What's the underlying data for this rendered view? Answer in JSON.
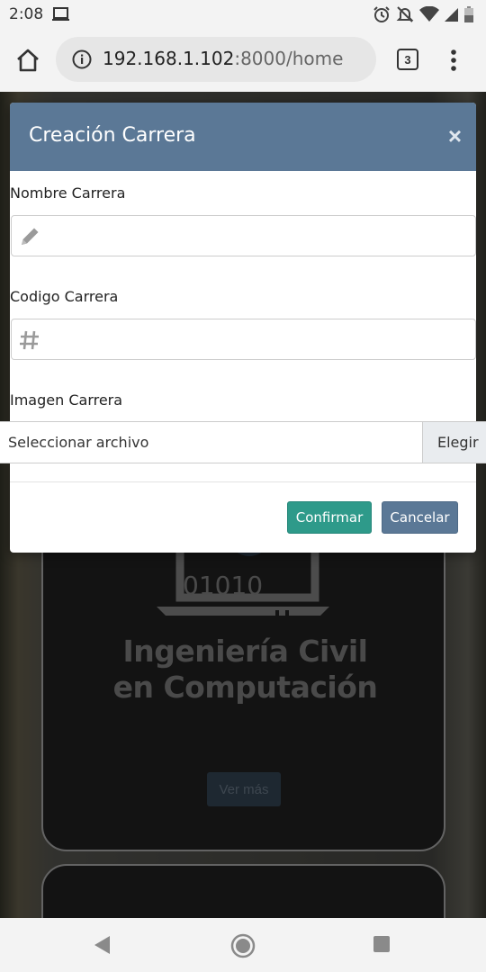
{
  "status_bar": {
    "time": "2:08",
    "icons": [
      "screen-cast-icon",
      "alarm-icon",
      "notifications-off-icon",
      "wifi-icon",
      "signal-icon",
      "battery-icon"
    ]
  },
  "browser": {
    "url_host": "192.168.1.102",
    "url_path": ":8000/home",
    "tab_count": "3"
  },
  "modal": {
    "title": "Creación Carrera",
    "close_label": "×",
    "fields": [
      {
        "label": "Nombre Carrera",
        "value": "",
        "icon": "pencil-icon"
      },
      {
        "label": "Codigo Carrera",
        "value": "",
        "icon": "hash-icon"
      }
    ],
    "image_label": "Imagen Carrera",
    "file_placeholder": "Seleccionar archivo",
    "file_button": "Elegir",
    "confirm_label": "Confirmar",
    "cancel_label": "Cancelar"
  },
  "background_card": {
    "binary_text": "01010",
    "title_line1": "Ingeniería Civil",
    "title_line2": "en Computación",
    "button_label": "Ver más"
  },
  "colors": {
    "modal_header": "#5b7896",
    "confirm": "#2e9a8a",
    "cancel": "#5b7896"
  }
}
